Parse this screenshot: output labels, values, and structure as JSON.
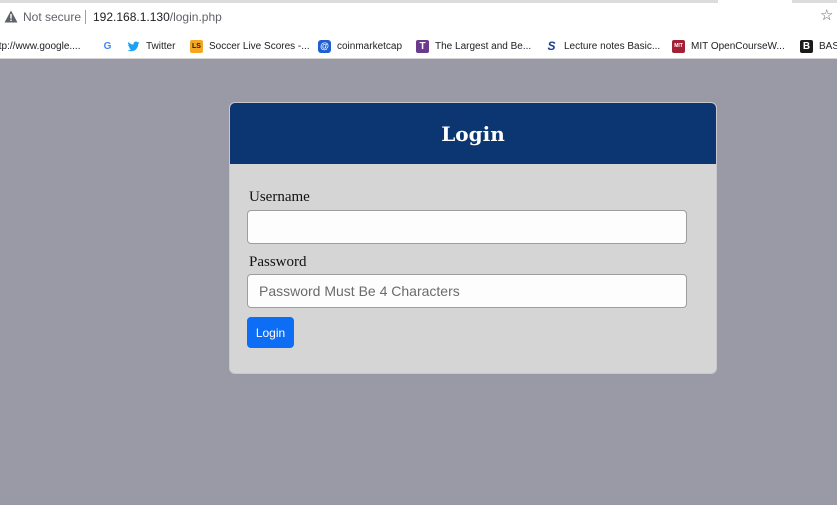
{
  "address_bar": {
    "security_text": "Not secure",
    "url_host": "192.168.1.130",
    "url_path": "/login.php"
  },
  "bookmarks": [
    {
      "label": "ttp://www.google....",
      "icon": "page-icon"
    },
    {
      "label": "",
      "icon": "google-icon",
      "glyph": "G"
    },
    {
      "label": "Twitter",
      "icon": "twitter-icon"
    },
    {
      "label": "Soccer Live Scores -...",
      "icon": "livescore-icon",
      "glyph": "LS"
    },
    {
      "label": "coinmarketcap",
      "icon": "coinmarketcap-icon",
      "glyph": "@"
    },
    {
      "label": "The Largest and Be...",
      "icon": "t-icon",
      "glyph": "T"
    },
    {
      "label": "Lecture notes Basic...",
      "icon": "s-icon",
      "glyph": "S"
    },
    {
      "label": "MIT OpenCourseW...",
      "icon": "mit-icon",
      "glyph": "MIT"
    },
    {
      "label": "BAS",
      "icon": "bas-icon",
      "glyph": "B"
    }
  ],
  "login": {
    "title": "Login",
    "username_label": "Username",
    "username_value": "",
    "password_label": "Password",
    "password_placeholder": "Password Must Be 4 Characters",
    "submit_label": "Login"
  },
  "colors": {
    "page_background": "#999aa6",
    "card_header": "#0b3672",
    "card_body": "#d6d5d5",
    "button": "#0d6ef5"
  }
}
